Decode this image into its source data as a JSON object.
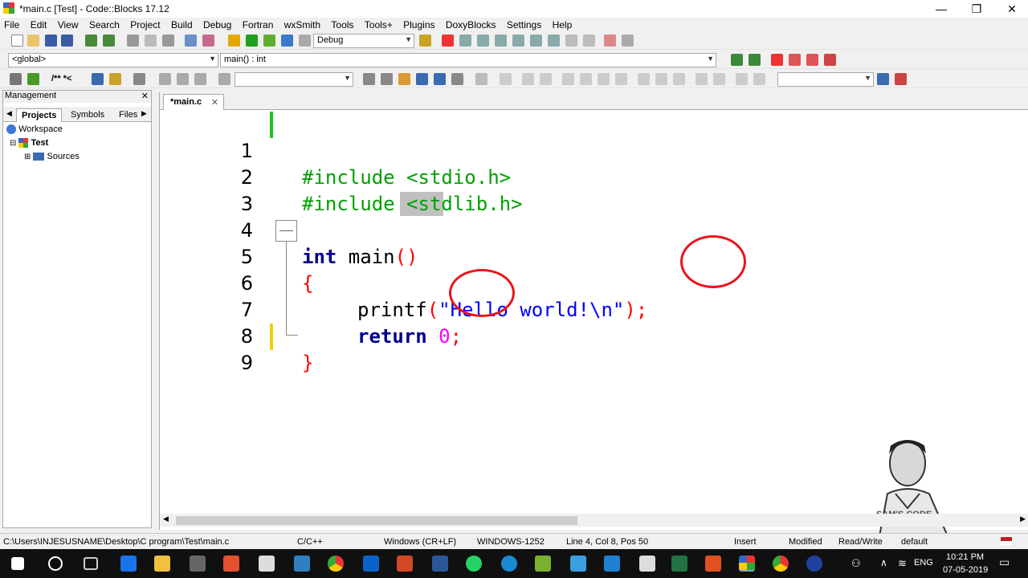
{
  "window": {
    "title": "*main.c [Test] - Code::Blocks 17.12",
    "minimize_glyph": "—",
    "maximize_glyph": "❐",
    "close_glyph": "✕"
  },
  "menu": [
    "File",
    "Edit",
    "View",
    "Search",
    "Project",
    "Build",
    "Debug",
    "Fortran",
    "wxSmith",
    "Tools",
    "Tools+",
    "Plugins",
    "DoxyBlocks",
    "Settings",
    "Help"
  ],
  "toolbar": {
    "build_target": "Debug",
    "scope": "<global>",
    "function": "main() : int",
    "doxy_label": "/** *<"
  },
  "management": {
    "title": "Management",
    "close_glyph": "✕",
    "tabs": [
      "Projects",
      "Symbols",
      "Files"
    ],
    "tree": {
      "workspace": "Workspace",
      "project": "Test",
      "folder": "Sources",
      "expand_minus": "⊟",
      "expand_plus": "⊞"
    }
  },
  "editor": {
    "tab_label": "*main.c",
    "tab_close": "✕",
    "lines": [
      {
        "num": "1",
        "code": "#include <stdio.h>"
      },
      {
        "num": "2",
        "code": "#include <stdlib.h>"
      },
      {
        "num": "3",
        "code": ""
      },
      {
        "num": "4",
        "kw": "int",
        "fn": " main",
        "paren": "()"
      },
      {
        "num": "5",
        "brace": "{"
      },
      {
        "num": "6",
        "fn": "printf",
        "p1": "(",
        "str": "\"Hello world!\\n\"",
        "p2": ");"
      },
      {
        "num": "7",
        "kw": "return",
        "num_val": "0",
        "semi": ";"
      },
      {
        "num": "8",
        "brace": "}"
      },
      {
        "num": "9",
        "code": ""
      }
    ]
  },
  "statusbar": {
    "path": "C:\\Users\\INJESUSNAME\\Desktop\\C program\\Test\\main.c",
    "language": "C/C++",
    "eol": "Windows (CR+LF)",
    "encoding": "WINDOWS-1252",
    "position": "Line 4, Col 8, Pos 50",
    "mode": "Insert",
    "modified": "Modified",
    "access": "Read/Write",
    "profile": "default"
  },
  "taskbar": {
    "time": "10:21 PM",
    "date": "07-05-2019",
    "language": "ENG",
    "watermark": "SAM'S CODE"
  },
  "colors": {
    "preprocessor": "#00a000",
    "keyword": "#00008b",
    "string": "#0000ff",
    "number": "#ff00ff",
    "annotation": "#e8151b"
  }
}
